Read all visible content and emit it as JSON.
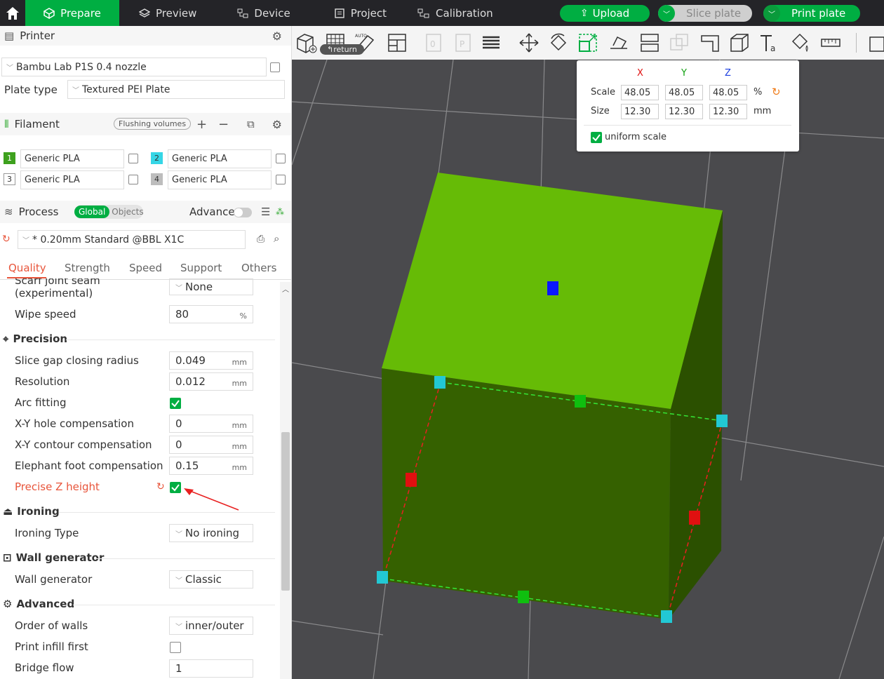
{
  "topbar": {
    "tabs": [
      "Prepare",
      "Preview",
      "Device",
      "Project",
      "Calibration"
    ],
    "upload": "Upload",
    "slice": "Slice plate",
    "print": "Print plate"
  },
  "printer": {
    "title": "Printer",
    "name": "Bambu Lab P1S 0.4 nozzle",
    "plate_label": "Plate type",
    "plate_value": "Textured PEI Plate"
  },
  "filament": {
    "title": "Filament",
    "flushing": "Flushing volumes",
    "slots": [
      {
        "num": "1",
        "name": "Generic PLA",
        "color": "#3ea11e"
      },
      {
        "num": "2",
        "name": "Generic PLA",
        "color": "#35d6e6"
      },
      {
        "num": "3",
        "name": "Generic PLA",
        "color": "#ffffff"
      },
      {
        "num": "4",
        "name": "Generic PLA",
        "color": "#bdbdbd"
      }
    ]
  },
  "process": {
    "title": "Process",
    "global": "Global",
    "objects": "Objects",
    "advance": "Advance",
    "preset": "* 0.20mm Standard @BBL X1C",
    "tabs": [
      "Quality",
      "Strength",
      "Speed",
      "Support",
      "Others"
    ]
  },
  "settings": {
    "seam_label_1": "Scarf joint seam",
    "seam_label_2": "(experimental)",
    "seam_value": "None",
    "wipe_label": "Wipe speed",
    "wipe_value": "80",
    "wipe_unit": "%",
    "precision_title": "Precision",
    "gap_label": "Slice gap closing radius",
    "gap_value": "0.049",
    "res_label": "Resolution",
    "res_value": "0.012",
    "arc_label": "Arc fitting",
    "xyhole_label": "X-Y hole compensation",
    "xyhole_value": "0",
    "xycont_label": "X-Y contour compensation",
    "xycont_value": "0",
    "elephant_label": "Elephant foot compensation",
    "elephant_value": "0.15",
    "pz_label": "Precise Z height",
    "ironing_title": "Ironing",
    "iron_label": "Ironing Type",
    "iron_value": "No ironing",
    "wall_title": "Wall generator",
    "wall_label": "Wall generator",
    "wall_value": "Classic",
    "adv_title": "Advanced",
    "order_label": "Order of walls",
    "order_value": "inner/outer",
    "infill_label": "Print infill first",
    "bridge_label": "Bridge flow",
    "bridge_value": "1",
    "unit_mm": "mm"
  },
  "toolbar": {
    "return": "return"
  },
  "scale_popup": {
    "x": "X",
    "y": "Y",
    "z": "Z",
    "scale_label": "Scale",
    "scale_values": [
      "48.05",
      "48.05",
      "48.05"
    ],
    "scale_unit": "%",
    "size_label": "Size",
    "size_values": [
      "12.30",
      "12.30",
      "12.30"
    ],
    "size_unit": "mm",
    "uniform": "uniform scale"
  },
  "colors": {
    "accent": "#00ae42",
    "cube_top": "#66bb06",
    "cube_side": "#356100",
    "highlight_red": "#e8553b"
  }
}
